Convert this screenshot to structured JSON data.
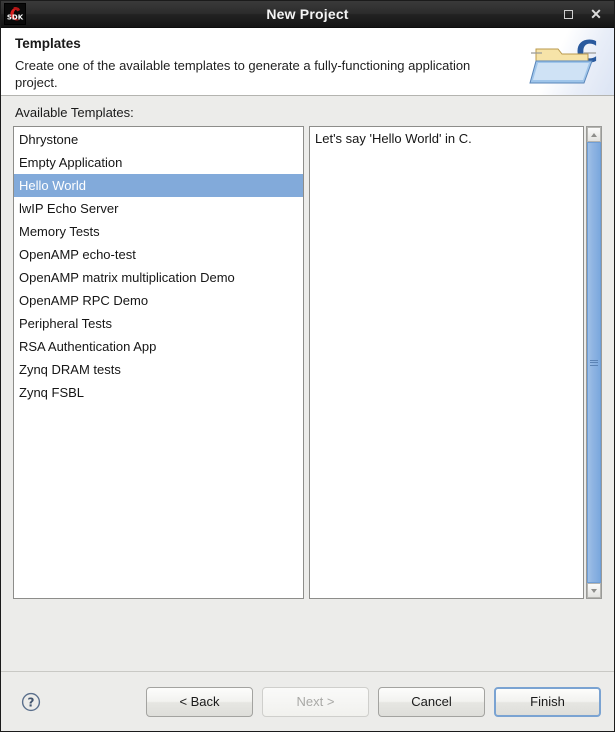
{
  "window": {
    "title": "New Project",
    "app_icon": "sdk-icon",
    "maximize_label": "Maximize",
    "close_label": "Close"
  },
  "banner": {
    "title": "Templates",
    "description": "Create one of the available templates to generate a fully-functioning application project.",
    "art_icon": "c-project-folder-icon"
  },
  "main": {
    "list_label": "Available Templates:",
    "templates": [
      "Dhrystone",
      "Empty Application",
      "Hello World",
      "lwIP Echo Server",
      "Memory Tests",
      "OpenAMP echo-test",
      "OpenAMP matrix multiplication Demo",
      "OpenAMP RPC Demo",
      "Peripheral Tests",
      "RSA Authentication App",
      "Zynq DRAM tests",
      "Zynq FSBL"
    ],
    "selected_index": 2,
    "description_text": "Let's say 'Hello World' in C."
  },
  "footer": {
    "help_icon": "help-question-icon",
    "buttons": [
      {
        "label": "< Back",
        "state": "enabled",
        "name": "back-button"
      },
      {
        "label": "Next >",
        "state": "disabled",
        "name": "next-button"
      },
      {
        "label": "Cancel",
        "state": "enabled",
        "name": "cancel-button"
      },
      {
        "label": "Finish",
        "state": "default",
        "name": "finish-button"
      }
    ]
  },
  "colors": {
    "selection": "#82aada",
    "titlebar": "#222222",
    "body": "#ececea",
    "scrollbar_thumb": "#8fb4e2",
    "default_button_border": "#7aa3d2"
  }
}
